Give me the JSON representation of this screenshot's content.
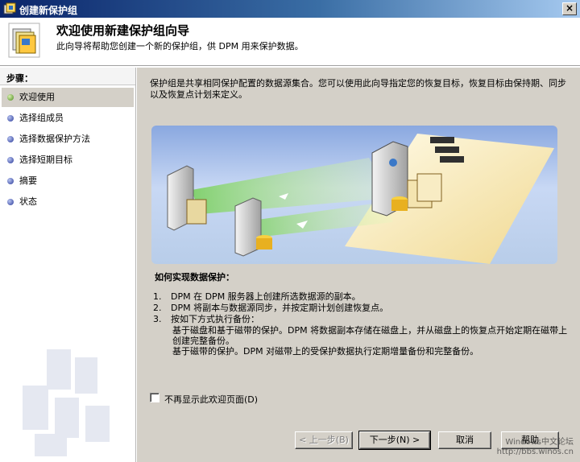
{
  "window": {
    "title": "创建新保护组"
  },
  "header": {
    "heading": "欢迎使用新建保护组向导",
    "subheading": "此向导将帮助您创建一个新的保护组，供 DPM 用来保护数据。"
  },
  "sidebar": {
    "steps_label": "步骤：",
    "items": [
      {
        "label": "欢迎使用",
        "active": true
      },
      {
        "label": "选择组成员",
        "active": false
      },
      {
        "label": "选择数据保护方法",
        "active": false
      },
      {
        "label": "选择短期目标",
        "active": false
      },
      {
        "label": "摘要",
        "active": false
      },
      {
        "label": "状态",
        "active": false
      }
    ]
  },
  "content": {
    "intro": "保护组是共享相同保护配置的数据源集合。您可以使用此向导指定您的恢复目标，恢复目标由保持期、同步以及恢复点计划来定义。",
    "how_title": "如何实现数据保护：",
    "steps": [
      {
        "num": "1.",
        "text": "DPM 在 DPM 服务器上创建所选数据源的副本。"
      },
      {
        "num": "2.",
        "text": "DPM 将副本与数据源同步，并按定期计划创建恢复点。"
      },
      {
        "num": "3.",
        "text": "按如下方式执行备份："
      }
    ],
    "sub_items": [
      "基于磁盘和基于磁带的保护。DPM 将数据副本存储在磁盘上，并从磁盘上的恢复点开始定期在磁带上创建完整备份。",
      "基于磁带的保护。DPM 对磁带上的受保护数据执行定期增量备份和完整备份。"
    ],
    "checkbox_label": "不再显示此欢迎页面(D)",
    "checkbox_checked": false
  },
  "buttons": {
    "back": "< 上一步(B)",
    "next": "下一步(N) >",
    "cancel": "取消",
    "help": "帮助"
  },
  "overlay": {
    "forum_name": "Windows中文论坛",
    "forum_url": "http://bbs.winos.cn"
  },
  "colors": {
    "title_bar_start": "#0a246a",
    "title_bar_end": "#a6caf0",
    "dialog_face": "#d4d0c8",
    "active_step_bullet": "#4a8a1a",
    "step_bullet": "#2a3a9a"
  },
  "icons": [
    "app-icon",
    "close-icon",
    "protection-group-icon",
    "step-bullet-icon",
    "server-icon",
    "database-icon",
    "tape-library-icon"
  ]
}
